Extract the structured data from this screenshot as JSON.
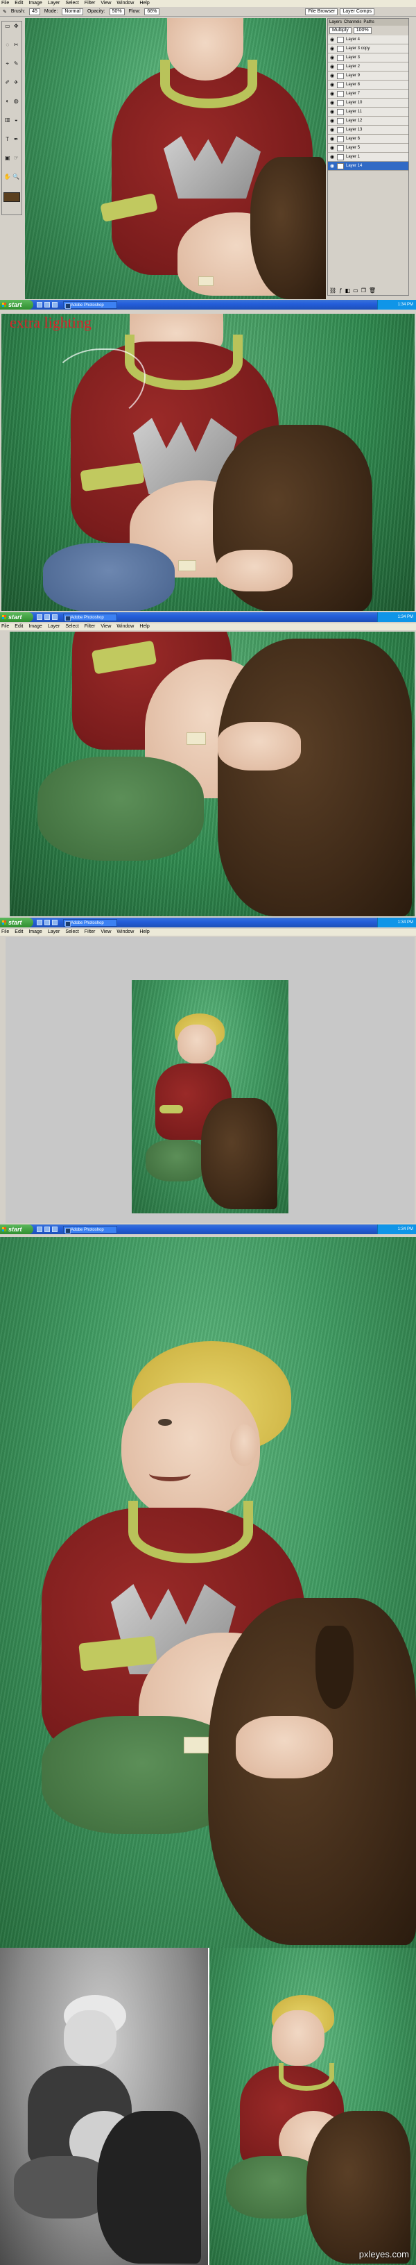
{
  "app": {
    "menu": [
      "File",
      "Edit",
      "Image",
      "Layer",
      "Select",
      "Filter",
      "View",
      "Window",
      "Help"
    ],
    "options_bar": {
      "brush_label": "Brush:",
      "brush_size": "45",
      "mode_label": "Mode:",
      "mode_value": "Normal",
      "opacity_label": "Opacity:",
      "opacity_value": "50%",
      "flow_label": "Flow:",
      "flow_value": "66%"
    },
    "tools": [
      "▭",
      "✥",
      "◌",
      "✂",
      "⌖",
      "✎",
      "✐",
      "✈",
      "◐",
      "◍",
      "▥",
      "◒",
      "T",
      "✒",
      "▣",
      "☞",
      "✋",
      "🔍"
    ]
  },
  "layers_panel": {
    "tabs": [
      "Layers",
      "Channels",
      "Paths"
    ],
    "blend_mode": "Multiply",
    "opacity": "100%",
    "layers": [
      "Layer 4",
      "Layer 3 copy",
      "Layer 3",
      "Layer 2",
      "Layer 9",
      "Layer 8",
      "Layer 7",
      "Layer 10",
      "Layer 11",
      "Layer 12",
      "Layer 13",
      "Layer 6",
      "Layer 5",
      "Layer 1",
      "Layer 14"
    ],
    "active_index": 14,
    "top_buttons": [
      "File Browser",
      "Layer Comps"
    ]
  },
  "taskbar": {
    "start": "start",
    "app_button": "Adobe Photoshop",
    "clock": "1:34 PM"
  },
  "annotation": "extra lighting",
  "watermark": "pxleyes.com",
  "colors": {
    "grass": "#3f9a61",
    "shirt": "#7a1c1c",
    "collar": "#b9c35a",
    "dog": "#3f2a18",
    "taskbar": "#245edb",
    "start": "#2f8f2f"
  }
}
